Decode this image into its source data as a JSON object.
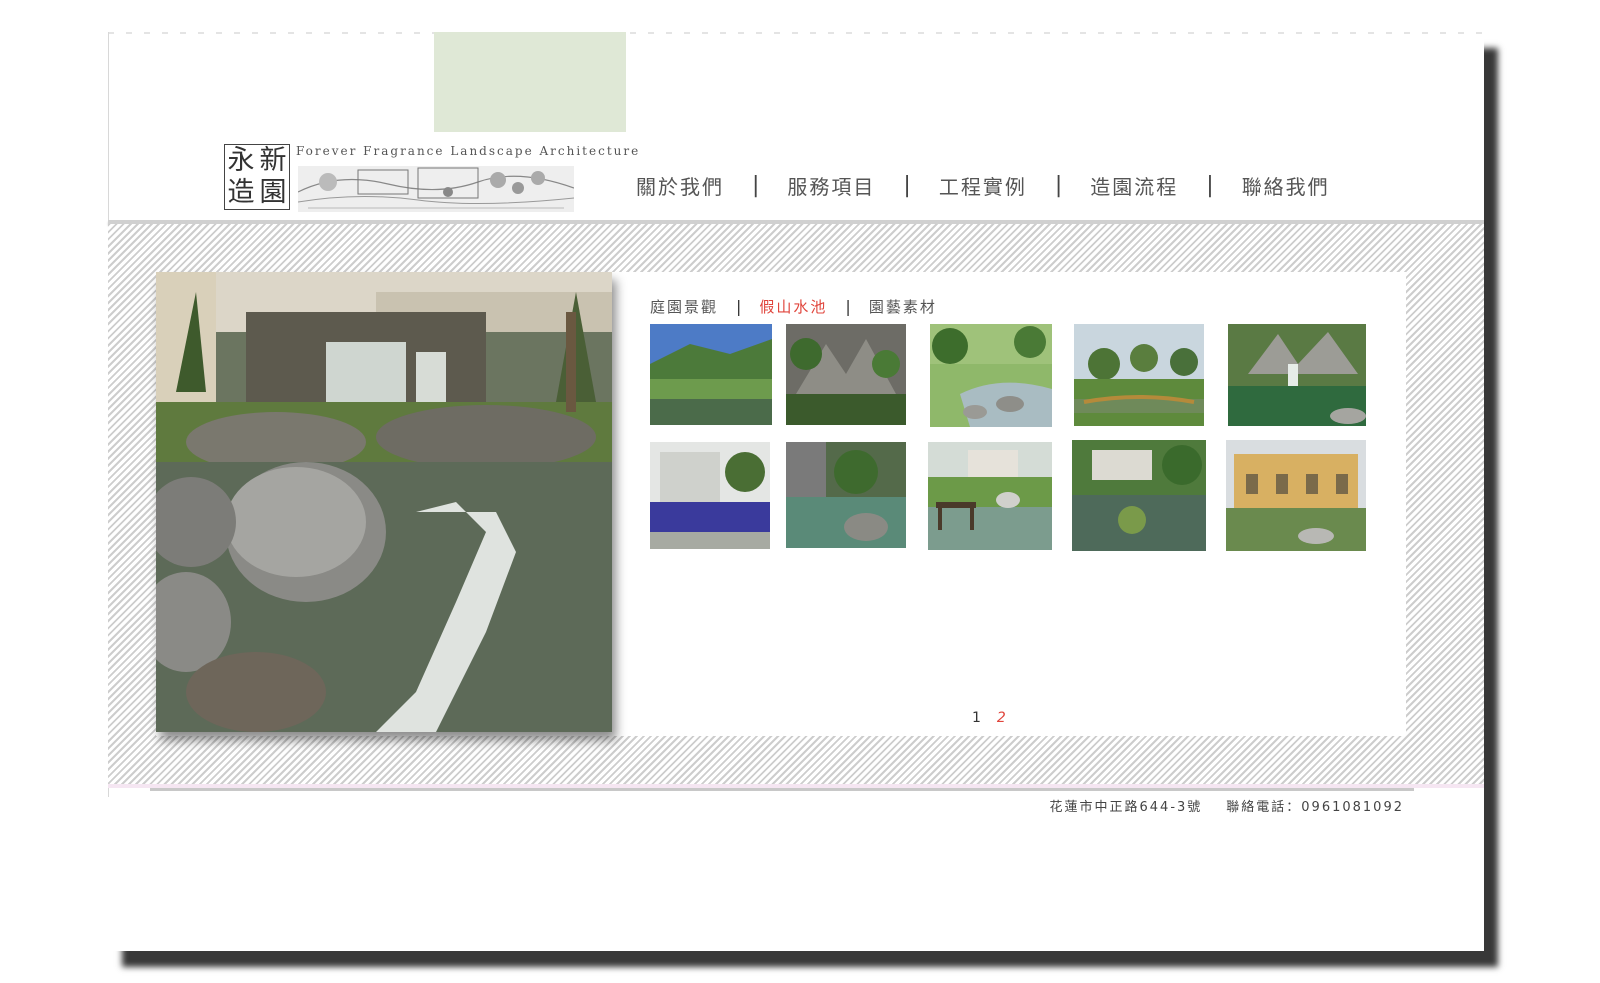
{
  "brand": {
    "seal_chars": [
      "永",
      "新",
      "造",
      "園"
    ],
    "english_name": "Forever Fragrance Landscape Architecture"
  },
  "nav": {
    "items": [
      {
        "label": "關於我們"
      },
      {
        "label": "服務項目"
      },
      {
        "label": "工程實例"
      },
      {
        "label": "造園流程"
      },
      {
        "label": "聯絡我們"
      }
    ],
    "separator": "|"
  },
  "subnav": {
    "items": [
      {
        "label": "庭園景觀",
        "active": false
      },
      {
        "label": "假山水池",
        "active": true
      },
      {
        "label": "園藝素材",
        "active": false
      }
    ],
    "separator": "|"
  },
  "gallery": {
    "hero_image": "rock-waterfall-pond-photo",
    "thumbnails": [
      "mountain-lake-thumbnail",
      "rockery-garden-thumbnail",
      "stepping-stone-pond-thumbnail",
      "wooden-bridge-pond-thumbnail",
      "rock-waterfall-thumbnail",
      "villa-pool-thumbnail",
      "koi-pond-thumbnail",
      "bridge-house-thumbnail",
      "garden-pond-thumbnail",
      "yellow-villa-thumbnail"
    ]
  },
  "pagination": {
    "pages": [
      "1",
      "2"
    ],
    "current": "2"
  },
  "footer": {
    "address": "花蓮市中正路644-3號",
    "phone": "聯絡電話：0961081092"
  },
  "colors": {
    "accent": "#e0453c",
    "header_block": "#dfe8d6",
    "text": "#555555"
  }
}
